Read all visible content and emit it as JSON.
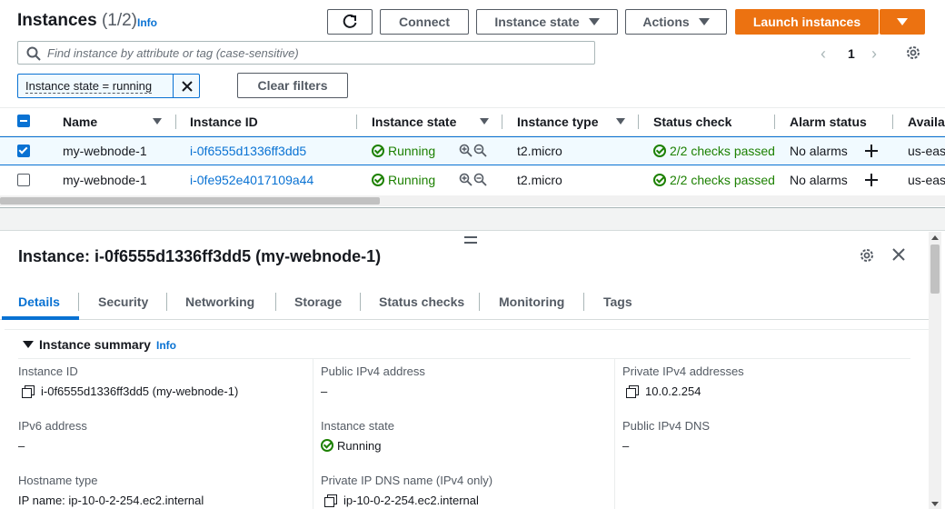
{
  "header": {
    "title": "Instances",
    "count": "(1/2)",
    "info": "Info",
    "buttons": {
      "connect": "Connect",
      "instance_state": "Instance state",
      "actions": "Actions",
      "launch": "Launch instances"
    }
  },
  "search": {
    "placeholder": "Find instance by attribute or tag (case-sensitive)"
  },
  "pagination": {
    "current_page": "1"
  },
  "filter": {
    "chip": "Instance state = running",
    "clear": "Clear filters"
  },
  "table": {
    "columns": [
      "Name",
      "Instance ID",
      "Instance state",
      "Instance type",
      "Status check",
      "Alarm status",
      "Availa"
    ],
    "rows": [
      {
        "name": "my-webnode-1",
        "id": "i-0f6555d1336ff3dd5",
        "state": "Running",
        "type": "t2.micro",
        "status": "2/2 checks passed",
        "alarm": "No alarms",
        "az": "us-eas",
        "selected": true
      },
      {
        "name": "my-webnode-1",
        "id": "i-0fe952e4017109a44",
        "state": "Running",
        "type": "t2.micro",
        "status": "2/2 checks passed",
        "alarm": "No alarms",
        "az": "us-eas",
        "selected": false
      }
    ]
  },
  "details": {
    "title": "Instance: i-0f6555d1336ff3dd5 (my-webnode-1)",
    "tabs": [
      "Details",
      "Security",
      "Networking",
      "Storage",
      "Status checks",
      "Monitoring",
      "Tags"
    ],
    "active_tab": "Details",
    "section_title": "Instance summary",
    "section_info": "Info",
    "fields": {
      "instance_id_label": "Instance ID",
      "instance_id_value": "i-0f6555d1336ff3dd5 (my-webnode-1)",
      "public_ipv4_label": "Public IPv4 address",
      "public_ipv4_value": "–",
      "private_ipv4_label": "Private IPv4 addresses",
      "private_ipv4_value": "10.0.2.254",
      "ipv6_label": "IPv6 address",
      "ipv6_value": "–",
      "instance_state_label": "Instance state",
      "instance_state_value": "Running",
      "public_dns_label": "Public IPv4 DNS",
      "public_dns_value": "–",
      "hostname_type_label": "Hostname type",
      "hostname_type_value": "IP name: ip-10-0-2-254.ec2.internal",
      "private_dns_label": "Private IP DNS name (IPv4 only)",
      "private_dns_value": "ip-10-0-2-254.ec2.internal"
    }
  },
  "colors": {
    "primary": "#ec7211",
    "link": "#0972d3",
    "success": "#1d8102",
    "selected_row_bg": "#f1faff"
  }
}
